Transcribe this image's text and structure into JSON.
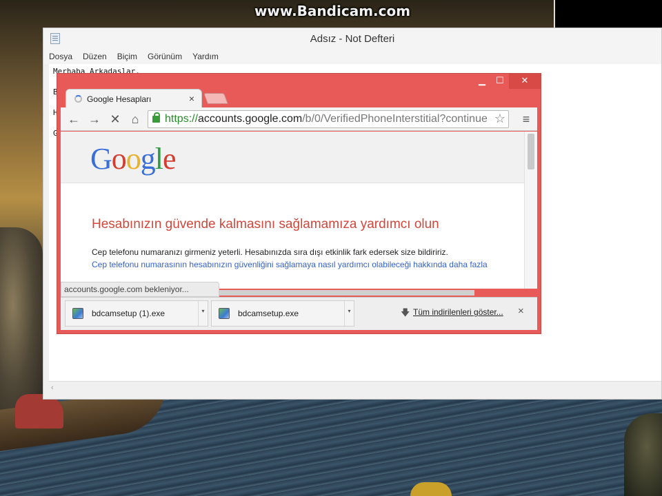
{
  "watermark": "www.Bandicam.com",
  "notepad": {
    "title": "Adsız - Not Defteri",
    "menu": [
      "Dosya",
      "Düzen",
      "Biçim",
      "Görünüm",
      "Yardım"
    ],
    "lines": [
      "Merhaba Arkadaşlar,",
      "B",
      "H",
      "G"
    ],
    "scroll_left_icon": "‹"
  },
  "chrome": {
    "window_controls": {
      "minimize": "▁",
      "maximize": "☐",
      "close": "✕"
    },
    "tab": {
      "title": "Google Hesapları",
      "close": "×"
    },
    "nav": {
      "back": "←",
      "forward": "→",
      "stop": "✕",
      "home": "⌂",
      "menu": "≡",
      "star": "☆"
    },
    "url": {
      "scheme": "https://",
      "host": "accounts.google.com",
      "path": "/b/0/VerifiedPhoneInterstitial?continue"
    },
    "page": {
      "logo": [
        "G",
        "o",
        "o",
        "g",
        "l",
        "e"
      ],
      "heading": "Hesabınızın güvende kalmasını sağlamamıza yardımcı olun",
      "text": "Cep telefonu numaranızı girmeniz yeterli. Hesabınızda sıra dışı etkinlik fark edersek size bildiririz.",
      "link": "Cep telefonu numarasının hesabınızın güvenliğini sağlamaya nasıl yardımcı olabileceği hakkında daha fazla"
    },
    "status": "accounts.google.com bekleniyor...",
    "downloads": {
      "items": [
        {
          "name": "bdcamsetup (1).exe",
          "icon": "installer-icon"
        },
        {
          "name": "bdcamsetup.exe",
          "icon": "installer-icon"
        }
      ],
      "dropdown": "▾",
      "show_all_icon": "🡇",
      "show_all": "Tüm indirilenleri göster...",
      "close": "×"
    }
  }
}
